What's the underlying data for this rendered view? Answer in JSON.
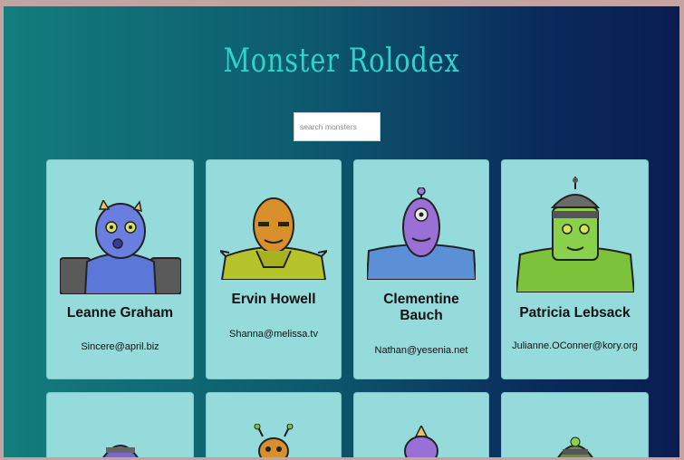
{
  "app": {
    "title": "Monster Rolodex"
  },
  "search": {
    "placeholder": "search monsters"
  },
  "monsters": [
    {
      "name": "Leanne Graham",
      "email": "Sincere@april.biz"
    },
    {
      "name": "Ervin Howell",
      "email": "Shanna@melissa.tv"
    },
    {
      "name": "Clementine Bauch",
      "email": "Nathan@yesenia.net"
    },
    {
      "name": "Patricia Lebsack",
      "email": "Julianne.OConner@kory.org"
    }
  ],
  "colors": {
    "accent": "#2fd4c8",
    "card": "#95dbdb",
    "gradient_start": "#137d7d",
    "gradient_end": "#0a1d52"
  }
}
